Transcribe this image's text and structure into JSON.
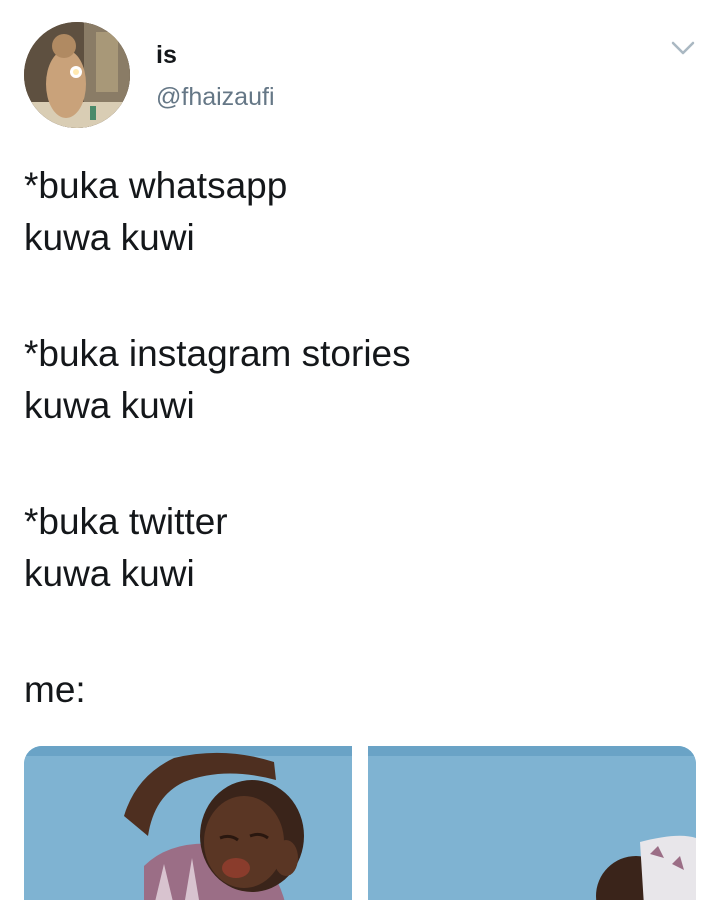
{
  "tweet": {
    "display_name": "is",
    "handle": "@fhaizaufi",
    "lines": [
      "*buka whatsapp",
      "kuwa kuwi",
      "",
      "*buka instagram stories",
      "kuwa kuwi",
      "",
      "*buka twitter",
      "kuwa kuwi",
      "",
      "me:"
    ]
  },
  "icons": {
    "menu": "chevron-down-icon"
  },
  "colors": {
    "text": "#14171a",
    "secondary": "#657786",
    "image_background": "#7fb3d2"
  }
}
